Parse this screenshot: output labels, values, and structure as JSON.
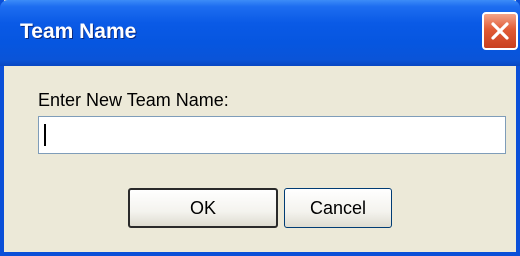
{
  "dialog": {
    "title": "Team Name",
    "prompt_label": "Enter New Team Name:",
    "input_value": "",
    "ok_label": "OK",
    "cancel_label": "Cancel",
    "close_icon": "close-icon"
  },
  "colors": {
    "titlebar": "#0a5ae6",
    "window_frame": "#0a4fd8",
    "dialog_body": "#ece9d8",
    "close_button": "#e15b35",
    "input_border": "#7f9db9"
  }
}
